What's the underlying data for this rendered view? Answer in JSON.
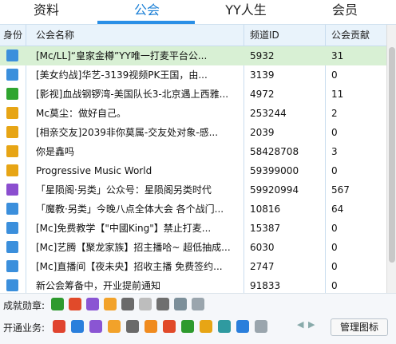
{
  "tabs": [
    {
      "label": "资料"
    },
    {
      "label": "公会"
    },
    {
      "label": "YY人生"
    },
    {
      "label": "会员"
    }
  ],
  "table": {
    "headers": {
      "role": "身份",
      "name": "公会名称",
      "id": "频道ID",
      "contribution": "公会贡献"
    },
    "rows": [
      {
        "role_color": "#3b8fdc",
        "name": "[Mc/LL]“皇家金樽”YY唯一打麦平台公...",
        "id": "5932",
        "contribution": "31"
      },
      {
        "role_color": "#3b8fdc",
        "name": "[美女约战]华艺-3139视频PK王国，由...",
        "id": "3139",
        "contribution": "0"
      },
      {
        "role_color": "#2fa52f",
        "name": "[影视]血战钢锣湾-美国队长3-北京遇上西雅...",
        "id": "4972",
        "contribution": "11"
      },
      {
        "role_color": "#e7a515",
        "name": "Mc莫尘：做好自己。",
        "id": "253244",
        "contribution": "2"
      },
      {
        "role_color": "#e7a515",
        "name": "[相亲交友]2039非你莫属-交友处对象-感...",
        "id": "2039",
        "contribution": "0"
      },
      {
        "role_color": "#e7a515",
        "name": "你是鑫吗",
        "id": "58428708",
        "contribution": "3"
      },
      {
        "role_color": "#e7a515",
        "name": "Progressive Music World",
        "id": "59399000",
        "contribution": "0"
      },
      {
        "role_color": "#8b4ecf",
        "name": "「星陨阁·另类」公众号：星陨阁另类时代",
        "id": "59920994",
        "contribution": "567"
      },
      {
        "role_color": "#3b8fdc",
        "name": "「魔教·另类」今晚八点全体大会  各个战门...",
        "id": "10816",
        "contribution": "64"
      },
      {
        "role_color": "#3b8fdc",
        "name": "[Mc]免费教学【\"中國King\"】禁止打麦...",
        "id": "15387",
        "contribution": "0"
      },
      {
        "role_color": "#3b8fdc",
        "name": "[Mc]艺腾【聚龙家族】招主播哈~ 超低抽成...",
        "id": "6030",
        "contribution": "0"
      },
      {
        "role_color": "#3b8fdc",
        "name": "[Mc]直播间【夜未央】招收主播 免费签约...",
        "id": "2747",
        "contribution": "0"
      },
      {
        "role_color": "#3b8fdc",
        "name": "新公会筹备中，开业提前通知",
        "id": "91833",
        "contribution": "0"
      }
    ]
  },
  "bottom": {
    "achievements_label": "成就勋章:",
    "services_label": "开通业务:",
    "manage_button": "管理图标",
    "achievement_icons": [
      "home-icon",
      "fire-icon",
      "star-icon",
      "heart-icon",
      "id-icon",
      "face-icon",
      "paw-icon",
      "box-icon",
      "chat-icon"
    ],
    "service_icons": [
      "vip-icon",
      "mail-icon",
      "s-icon",
      "user-icon",
      "tv-icon",
      "music-icon",
      "record-icon",
      "game-icon",
      "tag-icon",
      "plus-icon",
      "lock-icon",
      "cloud-icon"
    ]
  }
}
